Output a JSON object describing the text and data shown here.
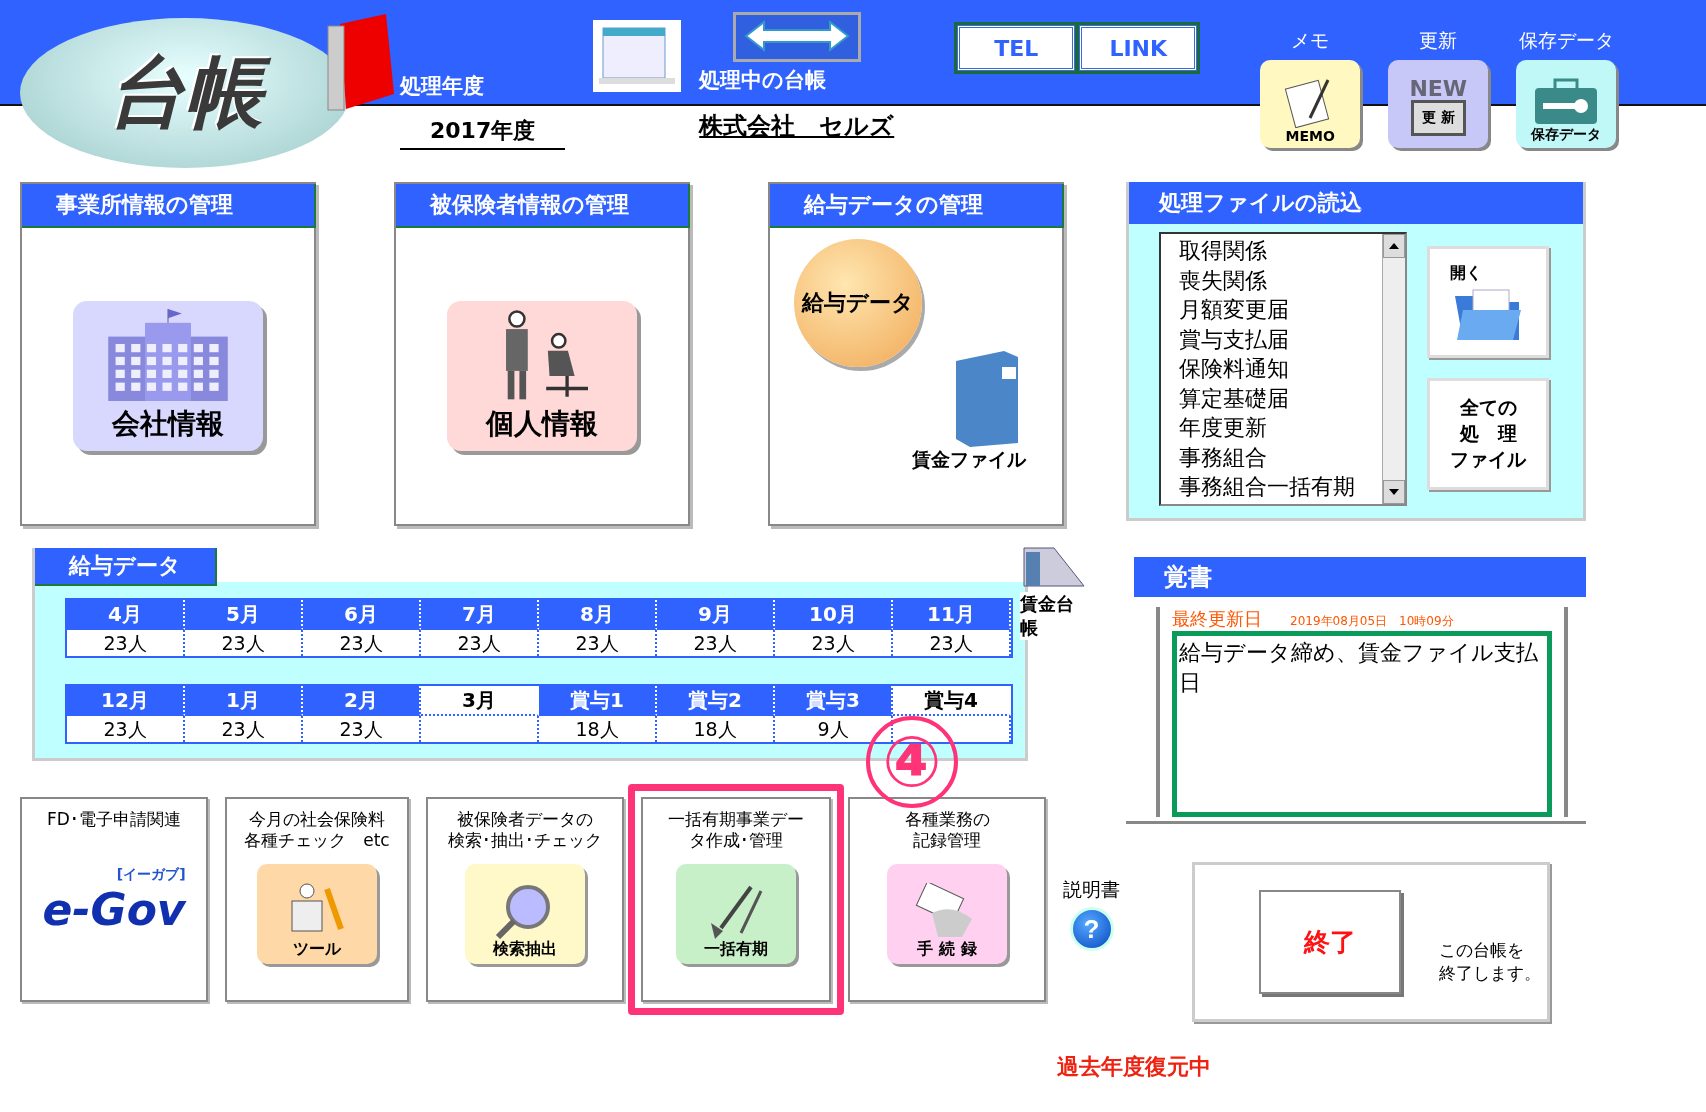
{
  "header": {
    "logo": "台帳",
    "year_label": "処理年度",
    "year": "2017年度",
    "ledger_label": "処理中の台帳",
    "company": "株式会社　セルズ",
    "links": [
      "TEL",
      "LINK"
    ],
    "tools": [
      {
        "label": "メモ",
        "icon_text": "MEMO",
        "kind": "memo"
      },
      {
        "label": "更新",
        "icon_text": "更 新",
        "badge": "NEW",
        "kind": "update"
      },
      {
        "label": "保存データ",
        "icon_text": "保存データ",
        "kind": "save"
      }
    ]
  },
  "modules": [
    {
      "title": "事業所情報の管理",
      "button": "会社情報",
      "kind": "building"
    },
    {
      "title": "被保険者情報の管理",
      "button": "個人情報",
      "kind": "people"
    },
    {
      "title": "給与データの管理",
      "button": "給与データ",
      "caption": "賃金ファイル",
      "kind": "payroll"
    }
  ],
  "salary": {
    "title": "給与データ",
    "ledger_caption": "賃金台帳",
    "rows": [
      [
        {
          "label": "4月",
          "count": "23人",
          "selected": false
        },
        {
          "label": "5月",
          "count": "23人",
          "selected": false
        },
        {
          "label": "6月",
          "count": "23人",
          "selected": false
        },
        {
          "label": "7月",
          "count": "23人",
          "selected": false
        },
        {
          "label": "8月",
          "count": "23人",
          "selected": false
        },
        {
          "label": "9月",
          "count": "23人",
          "selected": false
        },
        {
          "label": "10月",
          "count": "23人",
          "selected": false
        },
        {
          "label": "11月",
          "count": "23人",
          "selected": false
        }
      ],
      [
        {
          "label": "12月",
          "count": "23人",
          "selected": false
        },
        {
          "label": "1月",
          "count": "23人",
          "selected": false
        },
        {
          "label": "2月",
          "count": "23人",
          "selected": false
        },
        {
          "label": "3月",
          "selected": true
        },
        {
          "label": "賞与1",
          "count": "18人",
          "selected": false
        },
        {
          "label": "賞与2",
          "count": "18人",
          "selected": false
        },
        {
          "label": "賞与3",
          "count": "9人",
          "selected": false
        },
        {
          "label": "賞与4",
          "selected": true
        }
      ]
    ]
  },
  "file_load": {
    "title": "処理ファイルの読込",
    "items": [
      "取得関係",
      "喪失関係",
      "月額変更届",
      "賞与支払届",
      "保険料通知",
      "算定基礎届",
      "年度更新",
      "事務組合",
      "事務組合一括有期"
    ],
    "open_label": "開く",
    "all_files": [
      "全ての",
      "処　理",
      "ファイル"
    ]
  },
  "memo": {
    "title": "覚書",
    "updated_label": "最終更新日",
    "updated_at": "2019年08月05日　10時09分",
    "text": "給与データ締め、賃金ファイル支払日"
  },
  "tasks": [
    {
      "label": [
        "FD･電子申請関連"
      ],
      "icon_text": "e-Gov",
      "icon_sub": "[イーガブ]",
      "kind": "egov",
      "highlighted": false
    },
    {
      "label": [
        "今月の社会保険料",
        "各種チェック　etc"
      ],
      "icon_text": "ツール",
      "kind": "tools",
      "highlighted": false
    },
    {
      "label": [
        "被保険者データの",
        "検索･抽出･チェック"
      ],
      "icon_text": "検索抽出",
      "kind": "search",
      "highlighted": false
    },
    {
      "label": [
        "一括有期事業デー",
        "タ作成･管理"
      ],
      "icon_text": "一括有期",
      "kind": "shovel",
      "highlighted": true
    },
    {
      "label": [
        "各種業務の",
        "記録管理"
      ],
      "icon_text": "手 続 録",
      "kind": "card",
      "highlighted": false
    }
  ],
  "help": {
    "label": "説明書",
    "icon": "?"
  },
  "exit": {
    "button": "終了",
    "note": [
      "この台帳を",
      "終了します。"
    ]
  },
  "status": "過去年度復元中",
  "annotation": "④"
}
